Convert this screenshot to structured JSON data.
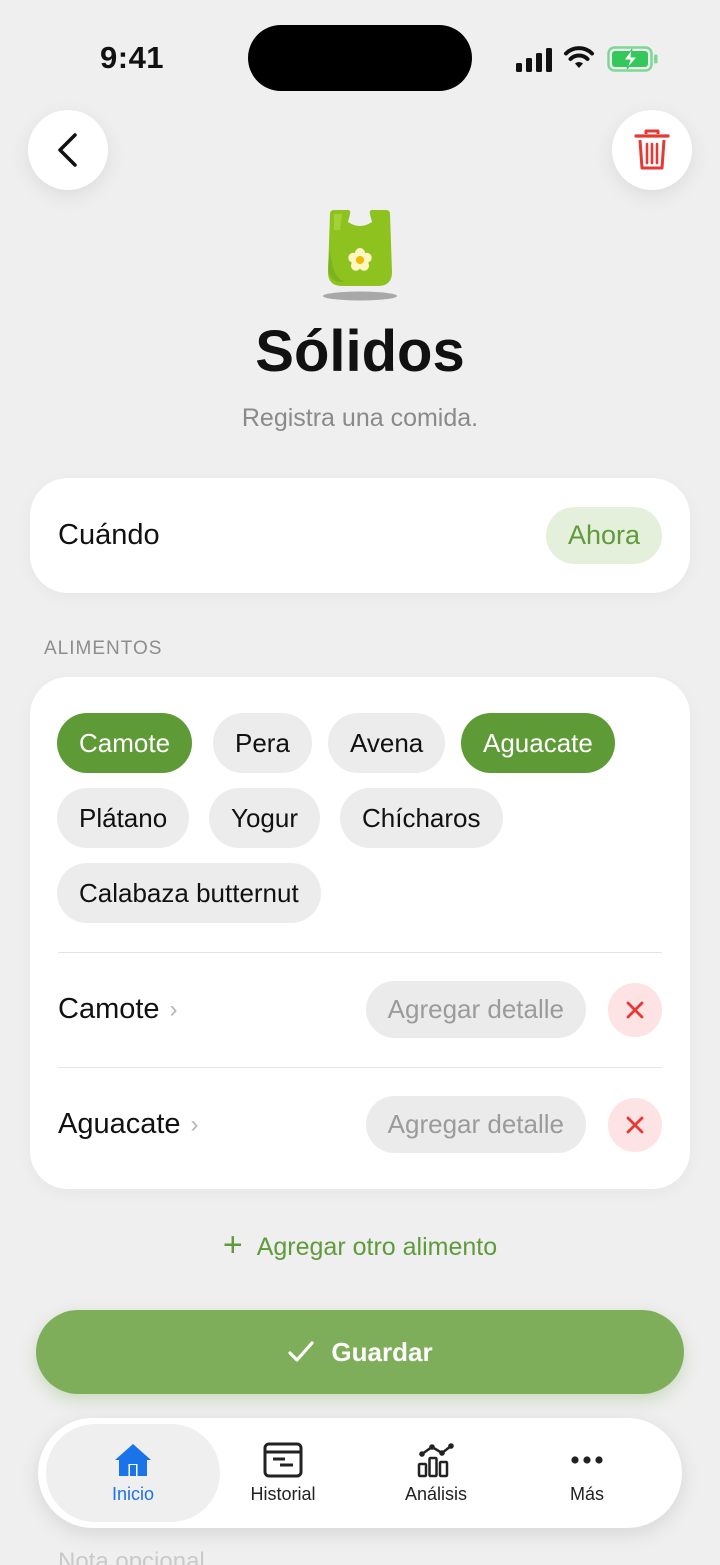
{
  "status_bar": {
    "time": "9:41"
  },
  "header": {
    "title": "Sólidos",
    "subtitle": "Registra una comida."
  },
  "when": {
    "label": "Cuándo",
    "value": "Ahora"
  },
  "foods": {
    "section_label": "ALIMENTOS",
    "chips": [
      {
        "label": "Camote",
        "selected": true
      },
      {
        "label": "Pera",
        "selected": false
      },
      {
        "label": "Avena",
        "selected": false
      },
      {
        "label": "Aguacate",
        "selected": true
      },
      {
        "label": "Plátano",
        "selected": false
      },
      {
        "label": "Yogur",
        "selected": false
      },
      {
        "label": "Chícharos",
        "selected": false
      },
      {
        "label": "Calabaza butternut",
        "selected": false
      }
    ],
    "selected_items": [
      {
        "name": "Camote",
        "detail_placeholder": "Agregar detalle"
      },
      {
        "name": "Aguacate",
        "detail_placeholder": "Agregar detalle"
      }
    ],
    "add_another": "Agregar otro alimento"
  },
  "save_label": "Guardar",
  "tabs": [
    {
      "label": "Inicio",
      "icon": "home-icon",
      "active": true
    },
    {
      "label": "Historial",
      "icon": "history-icon",
      "active": false
    },
    {
      "label": "Análisis",
      "icon": "analytics-icon",
      "active": false
    },
    {
      "label": "Más",
      "icon": "more-icon",
      "active": false
    }
  ],
  "partial_note": "Nota opcional",
  "colors": {
    "accent_green": "#5e9a36",
    "save_green": "#7fae5a",
    "delete_red": "#e53935",
    "active_tab_blue": "#1a73e8"
  }
}
